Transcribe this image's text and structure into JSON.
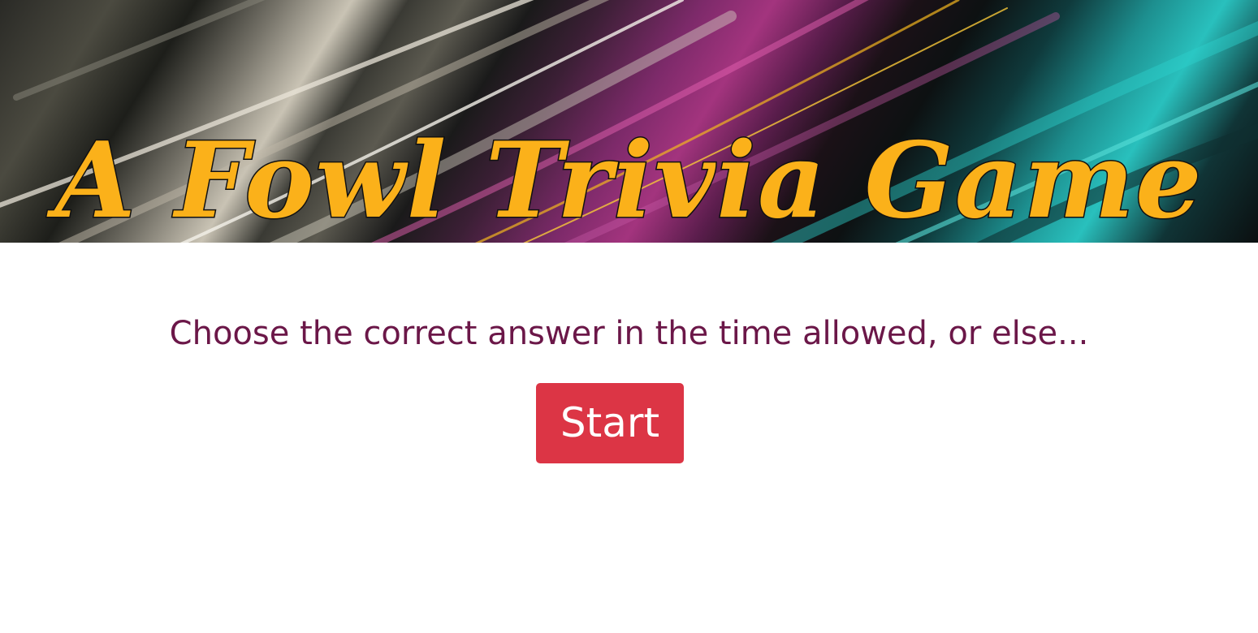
{
  "banner": {
    "title": "A Fowl Trivia Game"
  },
  "intro": {
    "instructions": "Choose the correct answer in the time allowed, or else..."
  },
  "actions": {
    "start_label": "Start"
  },
  "colors": {
    "title": "#fbb11a",
    "title_outline": "#111111",
    "instructions": "#6b1748",
    "start_button": "#dc3545",
    "start_text": "#ffffff"
  }
}
